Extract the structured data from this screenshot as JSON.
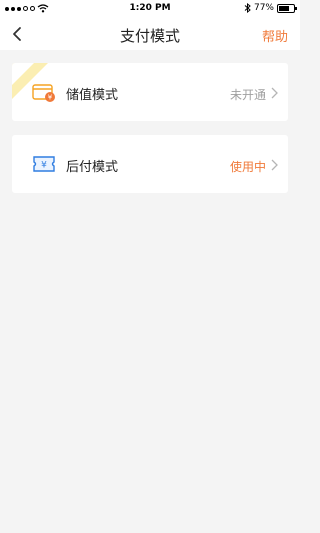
{
  "status_bar": {
    "time": "1:20 PM",
    "battery": "77%"
  },
  "nav": {
    "title": "支付模式",
    "help_label": "帮助"
  },
  "payment_modes": [
    {
      "label": "储值模式",
      "status": "未开通",
      "status_color": "#a0a0a0",
      "icon": "wallet-coin-icon"
    },
    {
      "label": "后付模式",
      "status": "使用中",
      "status_color": "#f07a3a",
      "icon": "yen-ticket-icon"
    }
  ],
  "colors": {
    "accent": "#f07a3a",
    "ribbon": "#fbeeb2",
    "background": "#f4f4f4"
  }
}
